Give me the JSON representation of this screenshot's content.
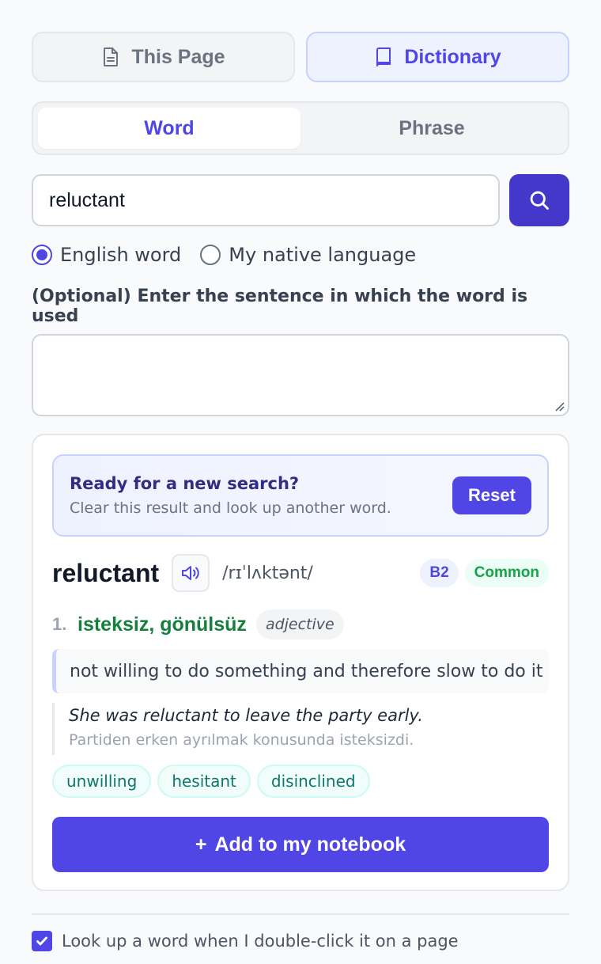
{
  "modes": {
    "this_page": {
      "label": "This Page",
      "icon": "document-icon"
    },
    "dictionary": {
      "label": "Dictionary",
      "icon": "book-icon",
      "active": true
    }
  },
  "segment": {
    "word": "Word",
    "phrase": "Phrase",
    "active": "word"
  },
  "search": {
    "value": "reluctant",
    "button_icon": "search-icon"
  },
  "language": {
    "english": "English word",
    "native": "My native language",
    "selected": "english"
  },
  "sentence": {
    "label": "(Optional) Enter the sentence in which the word is used",
    "value": ""
  },
  "result": {
    "banner": {
      "title": "Ready for a new search?",
      "subtitle": "Clear this result and look up another word.",
      "reset": "Reset"
    },
    "word": "reluctant",
    "speak_icon": "speaker-icon",
    "phonetic": "/rɪˈlʌktənt/",
    "level": "B2",
    "frequency": "Common",
    "senses": [
      {
        "number": "1.",
        "translation": "isteksiz, gönülsüz",
        "pos": "adjective",
        "definition": "not willing to do something and therefore slow to do it",
        "example_en": "She was reluctant to leave the party early.",
        "example_tr": "Partiden erken ayrılmak konusunda isteksizdi.",
        "synonyms": [
          "unwilling",
          "hesitant",
          "disinclined"
        ]
      }
    ],
    "add_button": "Add to my notebook",
    "add_icon": "+"
  },
  "footer": {
    "double_click_label": "Look up a word when I double-click it on a page",
    "double_click_checked": true
  },
  "colors": {
    "accent": "#4f46e5",
    "translation": "#15803d",
    "synonym": "#0f766e"
  }
}
